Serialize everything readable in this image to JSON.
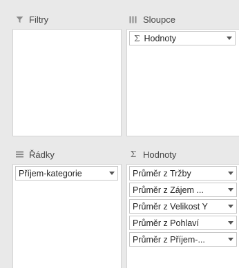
{
  "filters": {
    "title": "Filtry",
    "items": []
  },
  "columns": {
    "title": "Sloupce",
    "items": [
      {
        "label": "Hodnoty",
        "sigma": "Σ"
      }
    ]
  },
  "rows": {
    "title": "Řádky",
    "items": [
      {
        "label": "Příjem-kategorie"
      }
    ]
  },
  "values": {
    "title": "Hodnoty",
    "items": [
      {
        "label": "Průměr z Tržby"
      },
      {
        "label": "Průměr z Zájem ..."
      },
      {
        "label": "Průměr z Velikost Y"
      },
      {
        "label": "Průměr z Pohlaví"
      },
      {
        "label": "Průměr z Příjem-..."
      }
    ]
  },
  "icons": {
    "filters": "funnel-icon",
    "columns": "columns-icon",
    "rows": "rows-icon",
    "values": "sigma-icon",
    "dropdown": "dropdown-arrow-icon"
  }
}
